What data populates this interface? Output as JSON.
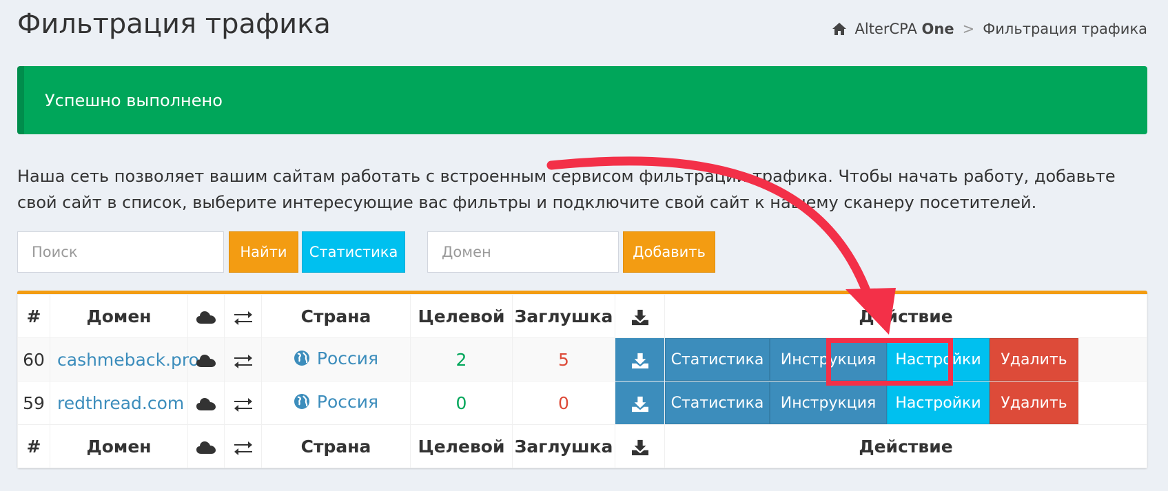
{
  "header": {
    "title": "Фильтрация трафика",
    "breadcrumb": {
      "brand": "AlterCPA",
      "brand_strong": "One",
      "separator": ">",
      "current": "Фильтрация трафика"
    }
  },
  "alert": {
    "text": "Успешно выполнено",
    "color": "#00a65a"
  },
  "intro": "Наша сеть позволяет вашим сайтам работать с встроенным сервисом фильтрации трафика. Чтобы начать работу, добавьте свой сайт в список, выберите интересующие вас фильтры и подключите свой сайт к нашему сканеру посетителей.",
  "toolbar": {
    "search_placeholder": "Поиск",
    "find_label": "Найти",
    "stats_label": "Статистика",
    "domain_placeholder": "Домен",
    "add_label": "Добавить"
  },
  "table": {
    "columns": {
      "num": "#",
      "domain": "Домен",
      "cloud_icon": "cloud-icon",
      "exchange_icon": "exchange-icon",
      "country": "Страна",
      "target": "Целевой",
      "stub": "Заглушка",
      "download_icon": "download-icon",
      "action": "Действие"
    },
    "rows": [
      {
        "id": "60",
        "domain": "cashmeback.pro",
        "country": "Россия",
        "target": "2",
        "stub": "5"
      },
      {
        "id": "59",
        "domain": "redthread.com",
        "country": "Россия",
        "target": "0",
        "stub": "0"
      }
    ],
    "actions": {
      "stats": "Статистика",
      "instruction": "Инструкция",
      "settings": "Настройки",
      "delete": "Удалить"
    }
  },
  "colors": {
    "warning": "#f39c12",
    "info": "#00c0ef",
    "primary": "#3c8dbc",
    "danger": "#dd4b39",
    "annotation": "#f33048"
  }
}
